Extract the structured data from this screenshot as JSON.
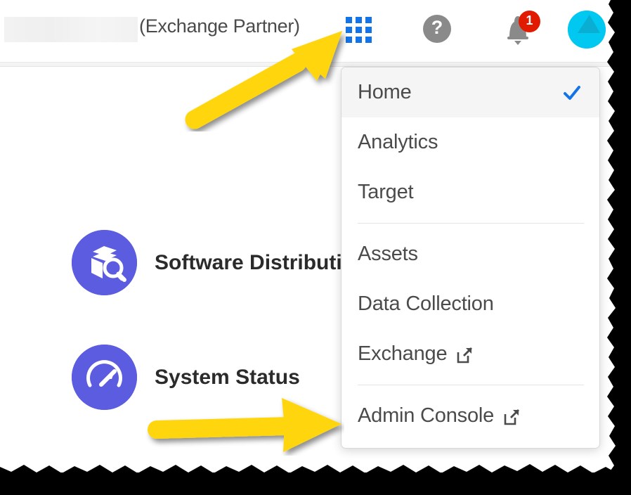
{
  "header": {
    "redacted_account_name": "",
    "org_label": "(Exchange Partner)",
    "app_grid_icon": "app-grid-icon",
    "help_icon": "help-icon",
    "help_glyph": "?",
    "bell_icon": "bell-icon",
    "notification_count": "1",
    "avatar_icon": "avatar-icon"
  },
  "main": {
    "tiles": [
      {
        "label": "Software Distribution",
        "icon": "package-search-icon"
      },
      {
        "label": "System Status",
        "icon": "gauge-icon"
      }
    ]
  },
  "app_menu": {
    "items": [
      {
        "label": "Home",
        "selected": true,
        "external": false,
        "check_icon": "checkmark-icon"
      },
      {
        "label": "Analytics",
        "selected": false,
        "external": false
      },
      {
        "label": "Target",
        "selected": false,
        "external": false
      },
      {
        "label": "Assets",
        "selected": false,
        "external": false
      },
      {
        "label": "Data Collection",
        "selected": false,
        "external": false
      },
      {
        "label": "Exchange",
        "selected": false,
        "external": true,
        "external_icon": "external-link-icon"
      },
      {
        "label": "Admin Console",
        "selected": false,
        "external": true,
        "external_icon": "external-link-icon"
      }
    ],
    "separator_after": [
      2,
      5
    ]
  },
  "annotations": {
    "arrows": [
      {
        "name": "arrow-to-app-grid",
        "points_to": "app-grid-icon"
      },
      {
        "name": "arrow-to-admin-console",
        "points_to": "Admin Console"
      }
    ]
  },
  "colors": {
    "accent_blue": "#1473E6",
    "tile_purple": "#5C5CE0",
    "badge_red": "#E01B00",
    "avatar_cyan": "#00C8F0",
    "arrow_yellow": "#FFD60A",
    "menu_text": "#4B4B4B"
  }
}
